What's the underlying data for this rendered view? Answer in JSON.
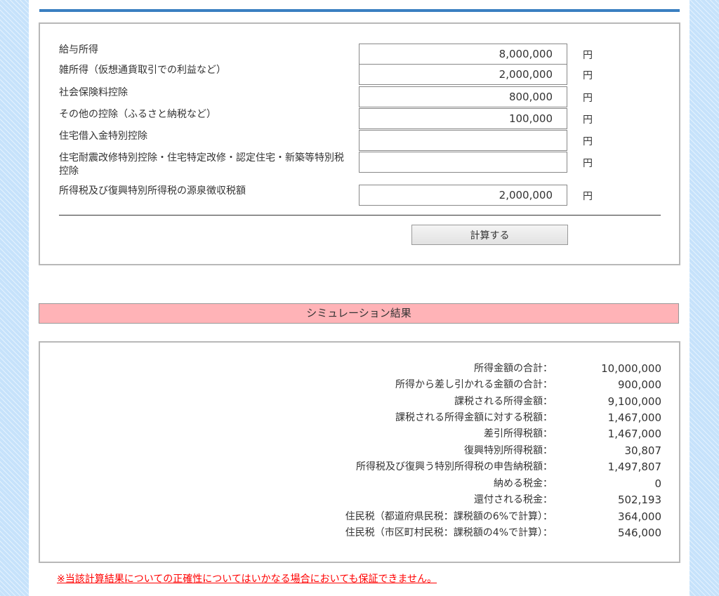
{
  "form": {
    "fields": [
      {
        "label": "給与所得",
        "value": "8,000,000",
        "unit": "円"
      },
      {
        "label": "雑所得（仮想通貨取引での利益など）",
        "value": "2,000,000",
        "unit": "円"
      },
      {
        "label": "社会保険料控除",
        "value": "800,000",
        "unit": "円"
      },
      {
        "label": "その他の控除（ふるさと納税など）",
        "value": "100,000",
        "unit": "円"
      },
      {
        "label": "住宅借入金特別控除",
        "value": "",
        "unit": "円"
      },
      {
        "label": "住宅耐震改修特別控除・住宅特定改修・認定住宅・新築等特別税控除",
        "value": "",
        "unit": "円"
      },
      {
        "label": "所得税及び復興特別所得税の源泉徴収税額",
        "value": "2,000,000",
        "unit": "円"
      }
    ],
    "calculate_label": "計算する"
  },
  "results": {
    "title": "シミュレーション結果",
    "rows": [
      {
        "label": "所得金額の合計：",
        "value": "10,000,000"
      },
      {
        "label": "所得から差し引かれる金額の合計：",
        "value": "900,000"
      },
      {
        "label": "課税される所得金額：",
        "value": "9,100,000"
      },
      {
        "label": "課税される所得金額に対する税額：",
        "value": "1,467,000"
      },
      {
        "label": "差引所得税額：",
        "value": "1,467,000"
      },
      {
        "label": "復興特別所得税額：",
        "value": "30,807"
      },
      {
        "label": "所得税及び復興う特別所得税の申告納税額：",
        "value": "1,497,807"
      },
      {
        "label": "納める税金：",
        "value": "0"
      },
      {
        "label": "還付される税金：",
        "value": "502,193"
      },
      {
        "label": "住民税（都道府県民税：課税額の6%で計算）：",
        "value": "364,000"
      },
      {
        "label": "住民税（市区町村民税：課税額の4%で計算）：",
        "value": "546,000"
      }
    ]
  },
  "disclaimer": "※当該計算結果についての正確性についてはいかなる場合においても保証できません。",
  "colors": {
    "background": "#c6e2fb",
    "top_rule": "#3a7fc1",
    "result_header": "#ffb3b7",
    "disclaimer": "#ff0000"
  }
}
